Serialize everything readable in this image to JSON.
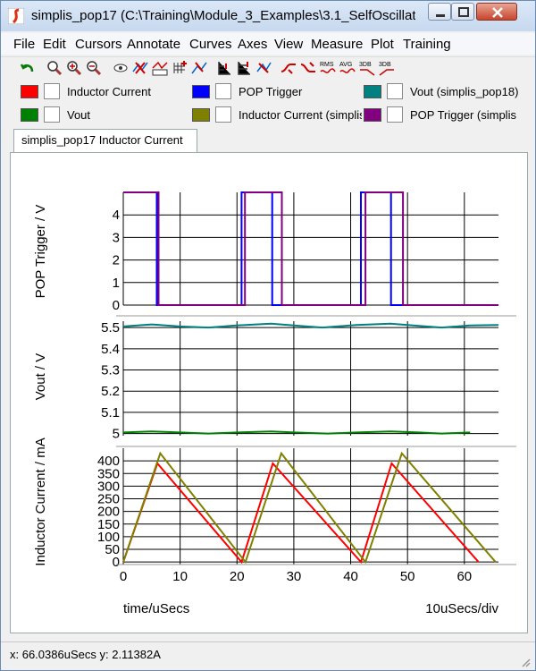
{
  "window": {
    "title": "simplis_pop17 (C:\\Training\\Module_3_Examples\\3.1_SelfOscillati..."
  },
  "menu": [
    "File",
    "Edit",
    "Cursors",
    "Annotate",
    "Curves",
    "Axes",
    "View",
    "Measure",
    "Plot",
    "Training"
  ],
  "toolbar": {
    "rms_label": "RMS",
    "avg_label": "AVG",
    "db1_label": "3DB",
    "db2_label": "3DB"
  },
  "legend": [
    {
      "label": "Inductor Current",
      "color": "#ff0000"
    },
    {
      "label": "POP Trigger",
      "color": "#0000ff"
    },
    {
      "label": "Vout (simplis_pop18)",
      "color": "#008080"
    },
    {
      "label": "Vout",
      "color": "#008000"
    },
    {
      "label": "Inductor Current (simplis",
      "color": "#808000"
    },
    {
      "label": "POP Trigger (simplis",
      "color": "#800080"
    }
  ],
  "tab": {
    "label": "simplis_pop17 Inductor Current"
  },
  "status": {
    "x_readout": "x: 66.0386uSecs",
    "y_readout": "y: 2.11382A"
  },
  "chart_data": [
    {
      "type": "line",
      "ylabel": "POP Trigger / V",
      "yticks": [
        0,
        1,
        2,
        3,
        4
      ],
      "ylim": [
        0,
        5
      ],
      "xlim": [
        0,
        66
      ],
      "grid": true,
      "series": [
        {
          "name": "POP Trigger",
          "color": "#0000ff",
          "points": [
            [
              0,
              5
            ],
            [
              5.9,
              5
            ],
            [
              5.9,
              0
            ],
            [
              20.8,
              0
            ],
            [
              20.8,
              5
            ],
            [
              26.2,
              5
            ],
            [
              26.2,
              0
            ],
            [
              41.8,
              0
            ],
            [
              41.8,
              5
            ],
            [
              47.1,
              5
            ],
            [
              47.1,
              0
            ],
            [
              66,
              0
            ]
          ]
        },
        {
          "name": "POP Trigger (simplis",
          "color": "#800080",
          "points": [
            [
              0,
              5
            ],
            [
              6.2,
              5
            ],
            [
              6.2,
              0
            ],
            [
              21.4,
              0
            ],
            [
              21.4,
              5
            ],
            [
              27.9,
              5
            ],
            [
              27.9,
              0
            ],
            [
              42.6,
              0
            ],
            [
              42.6,
              5
            ],
            [
              49.2,
              5
            ],
            [
              49.2,
              0
            ],
            [
              66,
              0
            ]
          ]
        }
      ]
    },
    {
      "type": "line",
      "ylabel": "Vout / V",
      "yticks": [
        5,
        5.1,
        5.2,
        5.3,
        5.4,
        5.5
      ],
      "ylim": [
        4.99,
        5.53
      ],
      "xlim": [
        0,
        66
      ],
      "grid": true,
      "series": [
        {
          "name": "Vout (simplis_pop18)",
          "color": "#008080",
          "points": [
            [
              0,
              5.505
            ],
            [
              5,
              5.515
            ],
            [
              10,
              5.505
            ],
            [
              15,
              5.5
            ],
            [
              20,
              5.51
            ],
            [
              26,
              5.518
            ],
            [
              30,
              5.51
            ],
            [
              35,
              5.5
            ],
            [
              41,
              5.512
            ],
            [
              47,
              5.518
            ],
            [
              52,
              5.508
            ],
            [
              56,
              5.5
            ],
            [
              61,
              5.51
            ],
            [
              66,
              5.512
            ]
          ]
        },
        {
          "name": "Vout",
          "color": "#008000",
          "points": [
            [
              0,
              5.005
            ],
            [
              5,
              5.01
            ],
            [
              10,
              5.005
            ],
            [
              15,
              5.0
            ],
            [
              20,
              5.005
            ],
            [
              26,
              5.01
            ],
            [
              30,
              5.005
            ],
            [
              36,
              5.0
            ],
            [
              41,
              5.005
            ],
            [
              47,
              5.01
            ],
            [
              52,
              5.005
            ],
            [
              56,
              5.0
            ],
            [
              61,
              5.005
            ]
          ]
        }
      ]
    },
    {
      "type": "line",
      "ylabel": "Inductor Current / mA",
      "xlabel": "time/uSecs",
      "xunits": "10uSecs/div",
      "yticks": [
        0,
        50,
        100,
        150,
        200,
        250,
        300,
        350,
        400
      ],
      "ylim": [
        -10,
        450
      ],
      "xticks": [
        0,
        10,
        20,
        30,
        40,
        50,
        60
      ],
      "xlim": [
        0,
        66
      ],
      "grid": true,
      "series": [
        {
          "name": "Inductor Current",
          "color": "#ff0000",
          "points": [
            [
              0,
              0
            ],
            [
              6,
              390
            ],
            [
              20.8,
              0
            ],
            [
              26.3,
              390
            ],
            [
              41.8,
              0
            ],
            [
              47.2,
              390
            ],
            [
              62.5,
              0
            ]
          ]
        },
        {
          "name": "Inductor Current (simplis",
          "color": "#808000",
          "points": [
            [
              0,
              0
            ],
            [
              6.5,
              430
            ],
            [
              21.5,
              0
            ],
            [
              27.8,
              430
            ],
            [
              42.6,
              0
            ],
            [
              49,
              430
            ],
            [
              65.5,
              0
            ]
          ]
        }
      ]
    }
  ]
}
